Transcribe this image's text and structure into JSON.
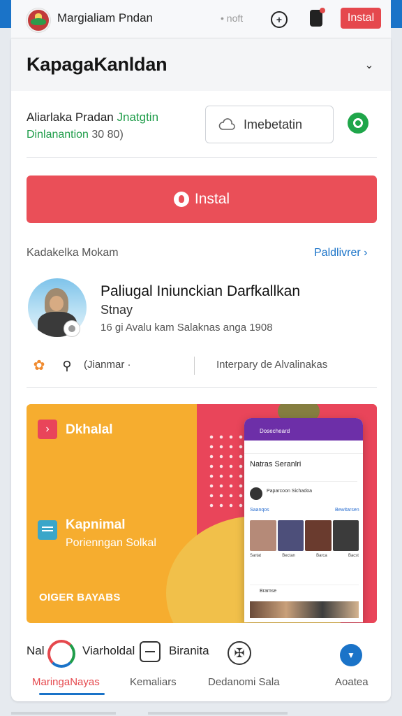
{
  "top_bar": {
    "app_name": "Margialiam Pndan",
    "meta": "• noft",
    "install_label": "Instal"
  },
  "header": {
    "title": "KapagaKanldan"
  },
  "developer": {
    "line1_prefix": "Aliarlaka Pradan",
    "line1_highlight": "Jnatgtin",
    "line2_prefix": "Dinlanantion",
    "line2_suffix": "30 80)",
    "secondary_button_label": "Imebetatin"
  },
  "install_button_label": "Instal",
  "reviews": {
    "label": "Kadakelka Mokam",
    "link": "Paldlivrer",
    "title": "Paliugal Iniunckian Darfkallkan",
    "subtitle": "Stnay",
    "meta": "16 gi Avalu kam Salaknas anga 1908",
    "action_label": "(Jianmar ·",
    "action_right": "Interpary de Alvalinakas"
  },
  "promo": {
    "feature1_title": "Dkhalal",
    "feature2_title": "Kapnimal",
    "feature2_sub": "Porienngan Solkal",
    "footer": "OIGER BAYABS",
    "phone": {
      "header": "Dosecheard",
      "section": "Natras Seranlri",
      "row": "Paparcoon Sichadoa",
      "sub_left": "Saanqos",
      "sub_right": "Bewitarsen",
      "captions": [
        "Sartat",
        "Bectan",
        "Barca",
        "Bacst"
      ],
      "bottom_title": "Bramse"
    }
  },
  "bottom_nav": {
    "top_left": "Nal",
    "top_mid": "Viarholdal",
    "top_right": "Biranita",
    "items": [
      {
        "label": "MaringaNayas",
        "active": true
      },
      {
        "label": "Kemaliars",
        "active": false
      },
      {
        "label": "Dedanomi Sala",
        "active": false
      },
      {
        "label": "Aoatea",
        "active": false
      }
    ]
  },
  "colors": {
    "accent_red": "#e5484d",
    "accent_blue": "#1a73c8",
    "accent_green": "#1f9d4a",
    "promo_yellow": "#f6ad2f",
    "promo_pink": "#e9455a"
  }
}
